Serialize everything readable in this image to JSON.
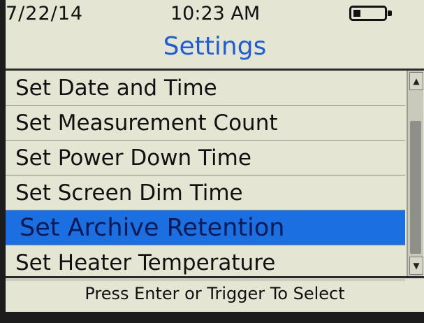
{
  "status": {
    "date": "7/22/14",
    "time": "10:23 AM",
    "battery_icon": "battery-low-icon"
  },
  "title": "Settings",
  "menu": {
    "items": [
      {
        "label": "Set Date and Time",
        "selected": false
      },
      {
        "label": "Set Measurement Count",
        "selected": false
      },
      {
        "label": "Set Power Down Time",
        "selected": false
      },
      {
        "label": "Set Screen Dim Time",
        "selected": false
      },
      {
        "label": "Set Archive Retention",
        "selected": true
      },
      {
        "label": "Set Heater Temperature",
        "selected": false
      }
    ]
  },
  "scrollbar": {
    "up_icon": "▲",
    "down_icon": "▼"
  },
  "footer": "Press Enter or Trigger To Select",
  "colors": {
    "accent": "#1e5ecf",
    "selection": "#1b6fe0",
    "background": "#e4e5d3"
  }
}
